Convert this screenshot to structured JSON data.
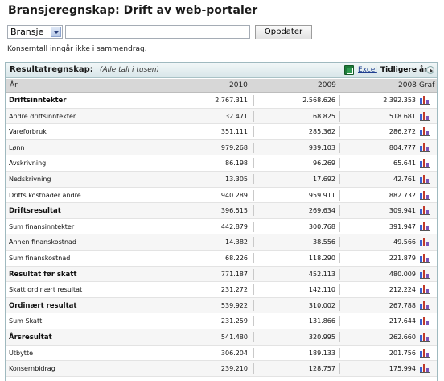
{
  "page": {
    "title": "Bransjeregnskap: Drift av web-portaler",
    "note": "Konserntall inngår ikke i sammendrag."
  },
  "controls": {
    "select_value": "Bransje",
    "search_value": "",
    "button_label": "Oppdater"
  },
  "panel": {
    "title": "Resultatregnskap:",
    "subtitle": "(Alle tall i tusen)",
    "excel_label": "Excel",
    "prev_label": "Tidligere år"
  },
  "table": {
    "headers": {
      "label": "År",
      "c1": "2010",
      "c2": "2009",
      "c3": "2008",
      "graf": "Graf"
    },
    "rows": [
      {
        "label": "Driftsinntekter",
        "bold": true,
        "v1": "2.767.311",
        "v2": "2.568.626",
        "v3": "2.392.353"
      },
      {
        "label": "Andre driftsinntekter",
        "bold": false,
        "v1": "32.471",
        "v2": "68.825",
        "v3": "518.681"
      },
      {
        "label": "Vareforbruk",
        "bold": false,
        "v1": "351.111",
        "v2": "285.362",
        "v3": "286.272"
      },
      {
        "label": "Lønn",
        "bold": false,
        "v1": "979.268",
        "v2": "939.103",
        "v3": "804.777"
      },
      {
        "label": "Avskrivning",
        "bold": false,
        "v1": "86.198",
        "v2": "96.269",
        "v3": "65.641"
      },
      {
        "label": "Nedskrivning",
        "bold": false,
        "v1": "13.305",
        "v2": "17.692",
        "v3": "42.761"
      },
      {
        "label": "Drifts kostnader andre",
        "bold": false,
        "v1": "940.289",
        "v2": "959.911",
        "v3": "882.732"
      },
      {
        "label": "Driftsresultat",
        "bold": true,
        "v1": "396.515",
        "v2": "269.634",
        "v3": "309.941"
      },
      {
        "label": "Sum finansinntekter",
        "bold": false,
        "v1": "442.879",
        "v2": "300.768",
        "v3": "391.947"
      },
      {
        "label": "Annen finanskostnad",
        "bold": false,
        "v1": "14.382",
        "v2": "38.556",
        "v3": "49.566"
      },
      {
        "label": "Sum finanskostnad",
        "bold": false,
        "v1": "68.226",
        "v2": "118.290",
        "v3": "221.879"
      },
      {
        "label": "Resultat før skatt",
        "bold": true,
        "v1": "771.187",
        "v2": "452.113",
        "v3": "480.009"
      },
      {
        "label": "Skatt ordinært resultat",
        "bold": false,
        "v1": "231.272",
        "v2": "142.110",
        "v3": "212.224"
      },
      {
        "label": "Ordinært resultat",
        "bold": true,
        "v1": "539.922",
        "v2": "310.002",
        "v3": "267.788"
      },
      {
        "label": "Sum Skatt",
        "bold": false,
        "v1": "231.259",
        "v2": "131.866",
        "v3": "217.644"
      },
      {
        "label": "Årsresultat",
        "bold": true,
        "v1": "541.480",
        "v2": "320.995",
        "v3": "262.660"
      },
      {
        "label": "Utbytte",
        "bold": false,
        "v1": "306.204",
        "v2": "189.133",
        "v3": "201.756"
      },
      {
        "label": "Konsernbidrag",
        "bold": false,
        "v1": "239.210",
        "v2": "128.757",
        "v3": "175.994"
      }
    ]
  },
  "icons": {
    "select_arrow": "chevron-down-icon",
    "excel": "excel-icon",
    "prev": "arrow-right-circle-icon",
    "graf": "bar-chart-icon"
  }
}
